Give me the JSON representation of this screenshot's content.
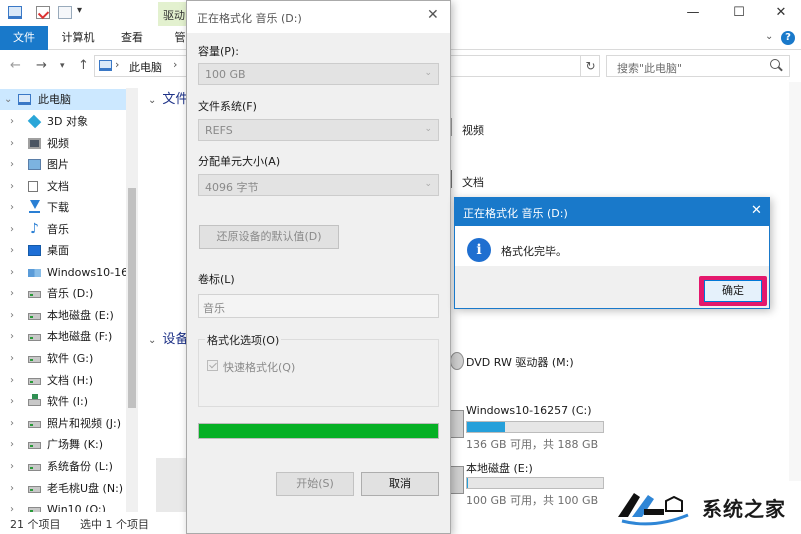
{
  "explorer": {
    "drive_tools_tab": "驱动",
    "ribbon_tabs": {
      "file": "文件",
      "computer": "计算机",
      "view": "查看",
      "manage": "管"
    },
    "address": "此电脑",
    "search_placeholder": "搜索\"此电脑\"",
    "sidebar": {
      "root": "此电脑",
      "items": [
        {
          "label": "3D 对象",
          "icon": "3d-objects-icon"
        },
        {
          "label": "视频",
          "icon": "video-folder-icon"
        },
        {
          "label": "图片",
          "icon": "pictures-folder-icon"
        },
        {
          "label": "文档",
          "icon": "documents-folder-icon"
        },
        {
          "label": "下载",
          "icon": "downloads-folder-icon"
        },
        {
          "label": "音乐",
          "icon": "music-folder-icon"
        },
        {
          "label": "桌面",
          "icon": "desktop-folder-icon"
        },
        {
          "label": "Windows10-16",
          "icon": "windows-drive-icon"
        },
        {
          "label": "音乐 (D:)",
          "icon": "drive-icon"
        },
        {
          "label": "本地磁盘 (E:)",
          "icon": "drive-icon"
        },
        {
          "label": "本地磁盘 (F:)",
          "icon": "drive-icon"
        },
        {
          "label": "软件 (G:)",
          "icon": "drive-icon"
        },
        {
          "label": "文档 (H:)",
          "icon": "drive-icon"
        },
        {
          "label": "软件 (I:)",
          "icon": "network-drive-icon"
        },
        {
          "label": "照片和视频 (J:)",
          "icon": "drive-icon"
        },
        {
          "label": "广场舞 (K:)",
          "icon": "drive-icon"
        },
        {
          "label": "系统备份 (L:)",
          "icon": "drive-icon"
        },
        {
          "label": "老毛桃U盘 (N:)",
          "icon": "drive-icon"
        },
        {
          "label": "Win10 (O:)",
          "icon": "drive-icon"
        }
      ]
    },
    "content": {
      "group_folders": "文件",
      "group_devices": "设备",
      "folders": [
        {
          "label": "视频"
        },
        {
          "label": "文档"
        }
      ],
      "drives": [
        {
          "name": "DVD RW 驱动器 (M:)"
        },
        {
          "name": "Windows10-16257 (C:)",
          "info": "136 GB 可用，共 188 GB",
          "used_fraction": 0.28
        },
        {
          "name": "本地磁盘 (E:)",
          "info": "100 GB 可用，共 100 GB",
          "used_fraction": 0.01
        }
      ]
    },
    "status": {
      "count": "21 个项目",
      "selected": "选中 1 个项目"
    }
  },
  "format_dialog": {
    "title": "正在格式化 音乐 (D:)",
    "capacity_label": "容量(P):",
    "capacity_value": "100 GB",
    "filesystem_label": "文件系统(F)",
    "filesystem_value": "REFS",
    "allocation_label": "分配单元大小(A)",
    "allocation_value": "4096 字节",
    "restore_defaults": "还原设备的默认值(D)",
    "volume_label_label": "卷标(L)",
    "volume_label_value": "音乐",
    "options_label": "格式化选项(O)",
    "quick_format_label": "快速格式化(Q)",
    "quick_format_checked": true,
    "progress_percent": 100,
    "progress_color": "#06b025",
    "start_button": "开始(S)",
    "cancel_button": "取消"
  },
  "message_box": {
    "title": "正在格式化 音乐 (D:)",
    "message": "格式化完毕。",
    "ok_button": "确定",
    "highlight_color": "#e4186c",
    "icon": "info-icon"
  },
  "watermark": {
    "text": "系统之家"
  },
  "colors": {
    "accent": "#1979ca",
    "selection": "#cce8ff"
  }
}
